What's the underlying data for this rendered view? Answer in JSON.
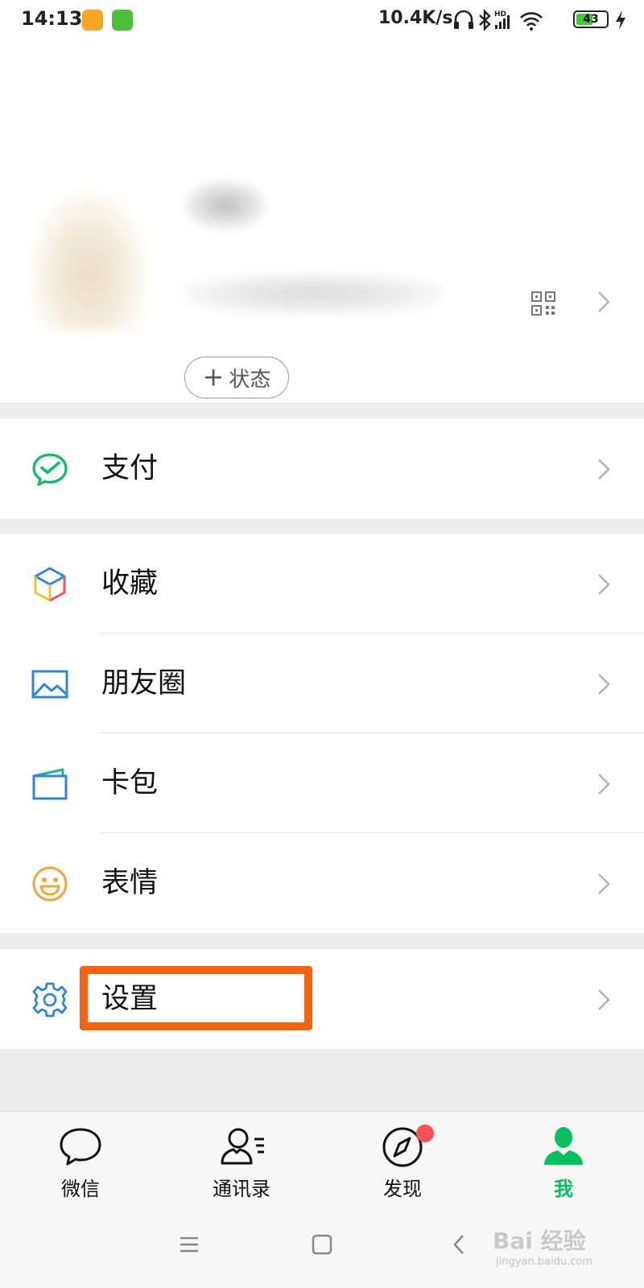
{
  "status_bar": {
    "time": "14:13",
    "network_speed": "10.4K/s",
    "battery": "43",
    "icons": [
      "headphones-icon",
      "bluetooth-icon",
      "hd-signal-icon",
      "wifi-icon",
      "battery-icon",
      "charging-icon"
    ]
  },
  "profile": {
    "status_button_label": "状态",
    "status_button_icon": "plus-icon"
  },
  "menu": {
    "pay": {
      "label": "支付",
      "icon": "pay-icon"
    },
    "favorites": {
      "label": "收藏",
      "icon": "favorites-cube-icon"
    },
    "moments": {
      "label": "朋友圈",
      "icon": "moments-picture-icon"
    },
    "cards": {
      "label": "卡包",
      "icon": "card-wallet-icon"
    },
    "stickers": {
      "label": "表情",
      "icon": "smiley-icon"
    },
    "settings": {
      "label": "设置",
      "icon": "gear-icon"
    }
  },
  "tabs": [
    {
      "label": "微信",
      "icon": "chat-bubble-icon",
      "active": false
    },
    {
      "label": "通讯录",
      "icon": "contacts-icon",
      "active": false
    },
    {
      "label": "发现",
      "icon": "compass-icon",
      "active": false,
      "badge": true
    },
    {
      "label": "我",
      "icon": "person-icon",
      "active": true
    }
  ],
  "watermark": {
    "text": "Bai 经验",
    "sub": "jingyan.baidu.com"
  },
  "colors": {
    "accent_green": "#07c160",
    "highlight_orange": "#f56311",
    "badge_red": "#fa5151",
    "page_background": "#ededed"
  }
}
